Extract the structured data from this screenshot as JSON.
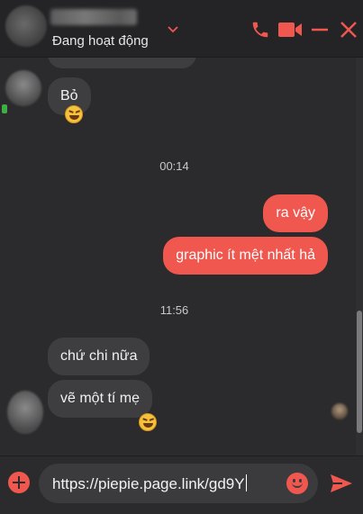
{
  "header": {
    "status": "Đang hoạt động"
  },
  "colors": {
    "accent": "#f0574f",
    "background": "#2b2b2d",
    "incoming_bubble": "#3e3e41"
  },
  "icons": {
    "call": "phone-icon",
    "video": "video-camera-icon",
    "minimize": "minimize-icon",
    "close": "close-icon"
  },
  "messages": [
    {
      "side": "in",
      "text": "Bỏ"
    },
    {
      "side": "time",
      "text": "00:14"
    },
    {
      "side": "out",
      "text": "ra vậy"
    },
    {
      "side": "out",
      "text": "graphic ít mệt nhất hả"
    },
    {
      "side": "time",
      "text": "11:56"
    },
    {
      "side": "in",
      "text": "chứ chi nữa"
    },
    {
      "side": "in",
      "text": "vẽ một tí mẹ"
    }
  ],
  "composer": {
    "value": "https://piepie.page.link/gd9Y"
  }
}
